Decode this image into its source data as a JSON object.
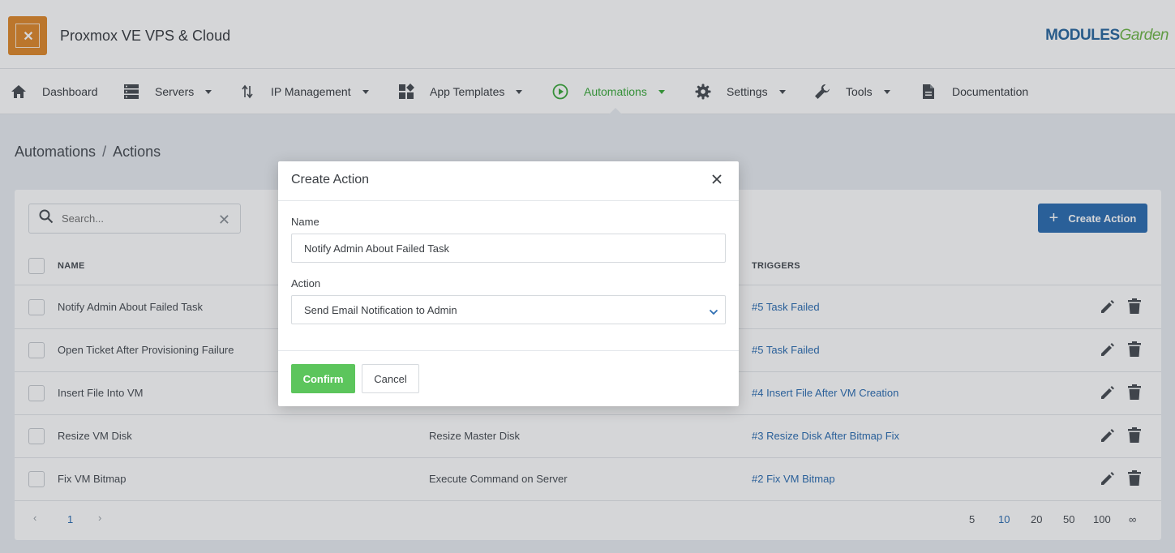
{
  "header": {
    "app_title": "Proxmox VE VPS & Cloud",
    "brand_part1": "MODULES",
    "brand_part2": "Garden"
  },
  "nav": {
    "items": [
      {
        "label": "Dashboard",
        "icon": "home-icon"
      },
      {
        "label": "Servers",
        "icon": "servers-icon"
      },
      {
        "label": "IP Management",
        "icon": "ip-arrows-icon"
      },
      {
        "label": "App Templates",
        "icon": "app-templates-icon"
      },
      {
        "label": "Automations",
        "icon": "play-circle-icon",
        "active": true
      },
      {
        "label": "Settings",
        "icon": "gear-icon"
      },
      {
        "label": "Tools",
        "icon": "wrench-icon"
      },
      {
        "label": "Documentation",
        "icon": "document-icon"
      }
    ]
  },
  "breadcrumb": {
    "parent": "Automations",
    "separator": "/",
    "current": "Actions"
  },
  "toolbar": {
    "search_placeholder": "Search...",
    "create_label": "Create Action"
  },
  "table": {
    "columns": [
      "NAME",
      "TRIGGERS"
    ],
    "rows": [
      {
        "name": "Notify Admin About Failed Task",
        "action": "",
        "trigger": "#5 Task Failed"
      },
      {
        "name": "Open Ticket After Provisioning Failure",
        "action": "",
        "trigger": "#5 Task Failed"
      },
      {
        "name": "Insert File Into VM",
        "action": "",
        "trigger": "#4 Insert File After VM Creation"
      },
      {
        "name": "Resize VM Disk",
        "action": "Resize Master Disk",
        "trigger": "#3 Resize Disk After Bitmap Fix"
      },
      {
        "name": "Fix VM Bitmap",
        "action": "Execute Command on Server",
        "trigger": "#2 Fix VM Bitmap"
      }
    ]
  },
  "pagination": {
    "prev": "‹",
    "current_page": "1",
    "next": "›",
    "page_sizes": [
      "5",
      "10",
      "20",
      "50",
      "100",
      "∞"
    ],
    "selected_size": "10"
  },
  "modal": {
    "title": "Create Action",
    "name_label": "Name",
    "name_value": "Notify Admin About Failed Task",
    "action_label": "Action",
    "action_value": "Send Email Notification to Admin",
    "confirm_label": "Confirm",
    "cancel_label": "Cancel"
  },
  "colors": {
    "accent_green": "#5cc55c",
    "nav_active": "#3daa3d",
    "link_blue": "#2f6fb3",
    "app_logo": "#e08a2e"
  }
}
